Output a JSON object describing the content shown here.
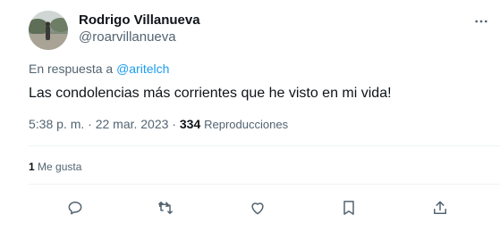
{
  "author": {
    "name": "Rodrigo Villanueva",
    "handle": "@roarvillanueva"
  },
  "reply": {
    "prefix": "En respuesta a",
    "mention": "@aritelch"
  },
  "tweet": {
    "text": "Las condolencias más corrientes que he visto en mi vida!",
    "time": "5:38 p. m. · 22 mar. 2023 ·",
    "views_count": "334",
    "views_label": "Reproducciones"
  },
  "stats": {
    "likes_count": "1",
    "likes_label": "Me gusta"
  },
  "icons": {
    "more": "more-horizontal-icon",
    "reply": "reply-icon",
    "retweet": "retweet-icon",
    "like": "heart-icon",
    "bookmark": "bookmark-icon",
    "share": "share-icon"
  },
  "colors": {
    "accent": "#1d9bf0",
    "text": "#0f1419",
    "secondary": "#536471",
    "divider": "#eff3f4"
  }
}
